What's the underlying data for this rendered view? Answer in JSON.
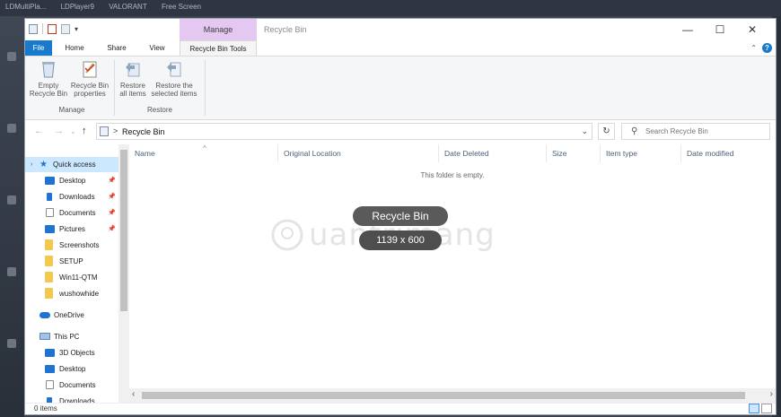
{
  "taskbar": {
    "titles": [
      "LDMultiPla...",
      "LDPlayer9",
      "VALORANT",
      "Free Screen"
    ]
  },
  "window": {
    "title": "Recycle Bin",
    "contextual_tab_group": "Manage",
    "buttons": {
      "minimize": "—",
      "maximize": "☐",
      "close": "✕"
    }
  },
  "ribbon_tabs": {
    "file": "File",
    "home": "Home",
    "share": "Share",
    "view": "View",
    "recycle_bin_tools": "Recycle Bin Tools"
  },
  "ribbon": {
    "manage": {
      "label": "Manage",
      "empty_line1": "Empty",
      "empty_line2": "Recycle Bin",
      "props_line1": "Recycle Bin",
      "props_line2": "properties"
    },
    "restore": {
      "label": "Restore",
      "all_line1": "Restore",
      "all_line2": "all items",
      "sel_line1": "Restore the",
      "sel_line2": "selected items"
    }
  },
  "address": {
    "path": "Recycle Bin",
    "separator": ">"
  },
  "search": {
    "placeholder": "Search Recycle Bin"
  },
  "nav": {
    "quick_access": "Quick access",
    "items": [
      {
        "label": "Desktop",
        "pinned": true,
        "color": "#1f74d1"
      },
      {
        "label": "Downloads",
        "pinned": true,
        "color": "#1f74d1"
      },
      {
        "label": "Documents",
        "pinned": true,
        "color": "#8a8a8a"
      },
      {
        "label": "Pictures",
        "pinned": true,
        "color": "#1f74d1"
      },
      {
        "label": "Screenshots",
        "pinned": false,
        "color": "#f2c94c"
      },
      {
        "label": "SETUP",
        "pinned": false,
        "color": "#f2c94c"
      },
      {
        "label": "Win11-QTM",
        "pinned": false,
        "color": "#f2c94c"
      },
      {
        "label": "wushowhide",
        "pinned": false,
        "color": "#f2c94c"
      }
    ],
    "onedrive": "OneDrive",
    "this_pc": "This PC",
    "pc_items": [
      {
        "label": "3D Objects",
        "color": "#1f74d1"
      },
      {
        "label": "Desktop",
        "color": "#1f74d1"
      },
      {
        "label": "Documents",
        "color": "#8a8a8a"
      },
      {
        "label": "Downloads",
        "color": "#1f74d1"
      }
    ]
  },
  "columns": [
    "Name",
    "Original Location",
    "Date Deleted",
    "Size",
    "Item type",
    "Date modified"
  ],
  "empty_message": "This folder is empty.",
  "status": {
    "count": "0 items"
  },
  "overlay": {
    "title": "Recycle Bin",
    "size": "1139 x 600"
  },
  "watermark": "uantrimang"
}
